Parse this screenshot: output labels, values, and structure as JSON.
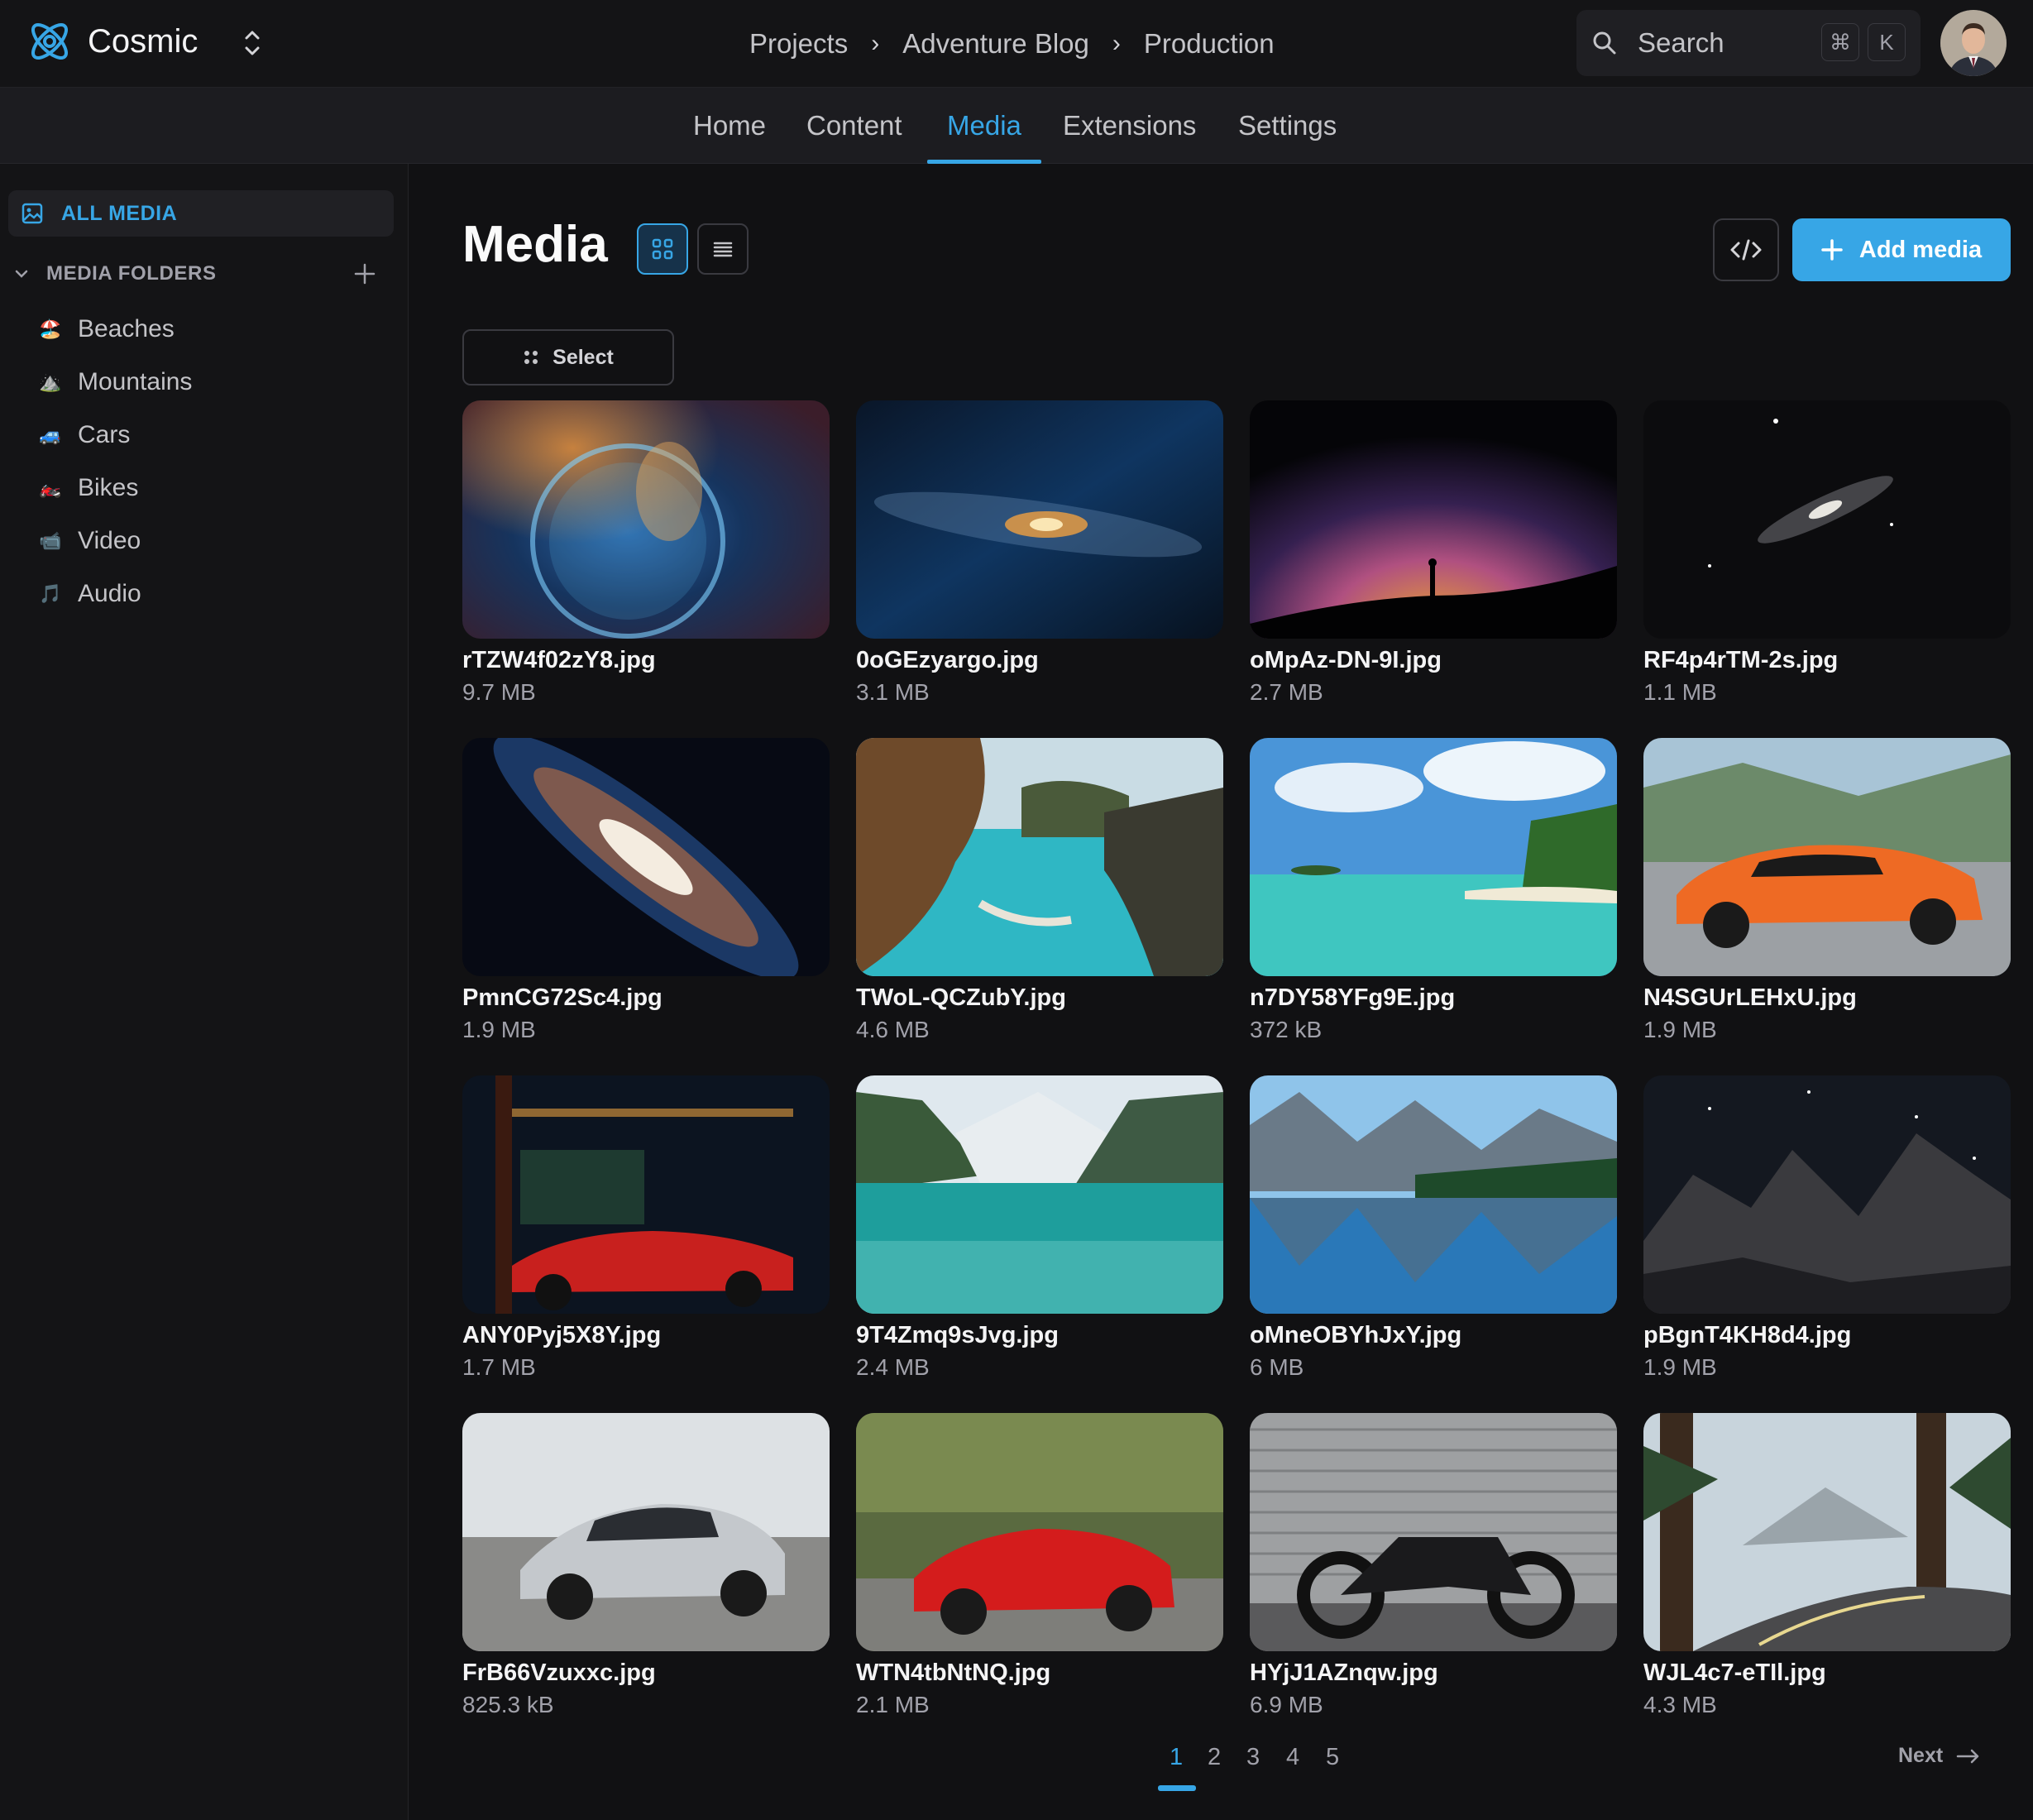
{
  "app": {
    "name": "Cosmic"
  },
  "breadcrumbs": [
    "Projects",
    "Adventure Blog",
    "Production"
  ],
  "search": {
    "label": "Search",
    "shortcut": [
      "⌘",
      "K"
    ]
  },
  "tabs": [
    {
      "label": "Home",
      "active": false
    },
    {
      "label": "Content",
      "active": false
    },
    {
      "label": "Media",
      "active": true
    },
    {
      "label": "Extensions",
      "active": false
    },
    {
      "label": "Settings",
      "active": false
    }
  ],
  "sidebar": {
    "all_media": "ALL MEDIA",
    "folders_heading": "MEDIA FOLDERS",
    "folders": [
      {
        "label": "Beaches",
        "icon": "🏖️"
      },
      {
        "label": "Mountains",
        "icon": "⛰️"
      },
      {
        "label": "Cars",
        "icon": "🚙"
      },
      {
        "label": "Bikes",
        "icon": "🏍️"
      },
      {
        "label": "Video",
        "icon": "📹"
      },
      {
        "label": "Audio",
        "icon": "🎵"
      }
    ]
  },
  "main": {
    "title": "Media",
    "add_label": "Add media",
    "select_label": "Select"
  },
  "media": [
    {
      "name": "rTZW4f02zY8.jpg",
      "size": "9.7 MB",
      "scene": "nebula-bubble"
    },
    {
      "name": "0oGEzyargo.jpg",
      "size": "3.1 MB",
      "scene": "milky-way-band"
    },
    {
      "name": "oMpAz-DN-9I.jpg",
      "size": "2.7 MB",
      "scene": "night-sky-silhouette"
    },
    {
      "name": "RF4p4rTM-2s.jpg",
      "size": "1.1 MB",
      "scene": "galaxy-small"
    },
    {
      "name": "PmnCG72Sc4.jpg",
      "size": "1.9 MB",
      "scene": "andromeda-galaxy"
    },
    {
      "name": "TWoL-QCZubY.jpg",
      "size": "4.6 MB",
      "scene": "coast-cove"
    },
    {
      "name": "n7DY58YFg9E.jpg",
      "size": "372 kB",
      "scene": "tropical-beach"
    },
    {
      "name": "N4SGUrLEHxU.jpg",
      "size": "1.9 MB",
      "scene": "orange-supercar"
    },
    {
      "name": "ANY0Pyj5X8Y.jpg",
      "size": "1.7 MB",
      "scene": "red-car-night"
    },
    {
      "name": "9T4Zmq9sJvg.jpg",
      "size": "2.4 MB",
      "scene": "mountain-lake"
    },
    {
      "name": "oMneOBYhJxY.jpg",
      "size": "6 MB",
      "scene": "mountain-reflection"
    },
    {
      "name": "pBgnT4KH8d4.jpg",
      "size": "1.9 MB",
      "scene": "night-mountains"
    },
    {
      "name": "FrB66Vzuxxc.jpg",
      "size": "825.3 kB",
      "scene": "silver-car"
    },
    {
      "name": "WTN4tbNtNQ.jpg",
      "size": "2.1 MB",
      "scene": "red-convertible"
    },
    {
      "name": "HYjJ1AZnqw.jpg",
      "size": "6.9 MB",
      "scene": "motorcycle"
    },
    {
      "name": "WJL4c7-eTIl.jpg",
      "size": "4.3 MB",
      "scene": "forest-road"
    }
  ],
  "pagination": {
    "pages": [
      "1",
      "2",
      "3",
      "4",
      "5"
    ],
    "current": "1",
    "next_label": "Next"
  },
  "colors": {
    "accent": "#37a6e6",
    "background": "#111113"
  }
}
